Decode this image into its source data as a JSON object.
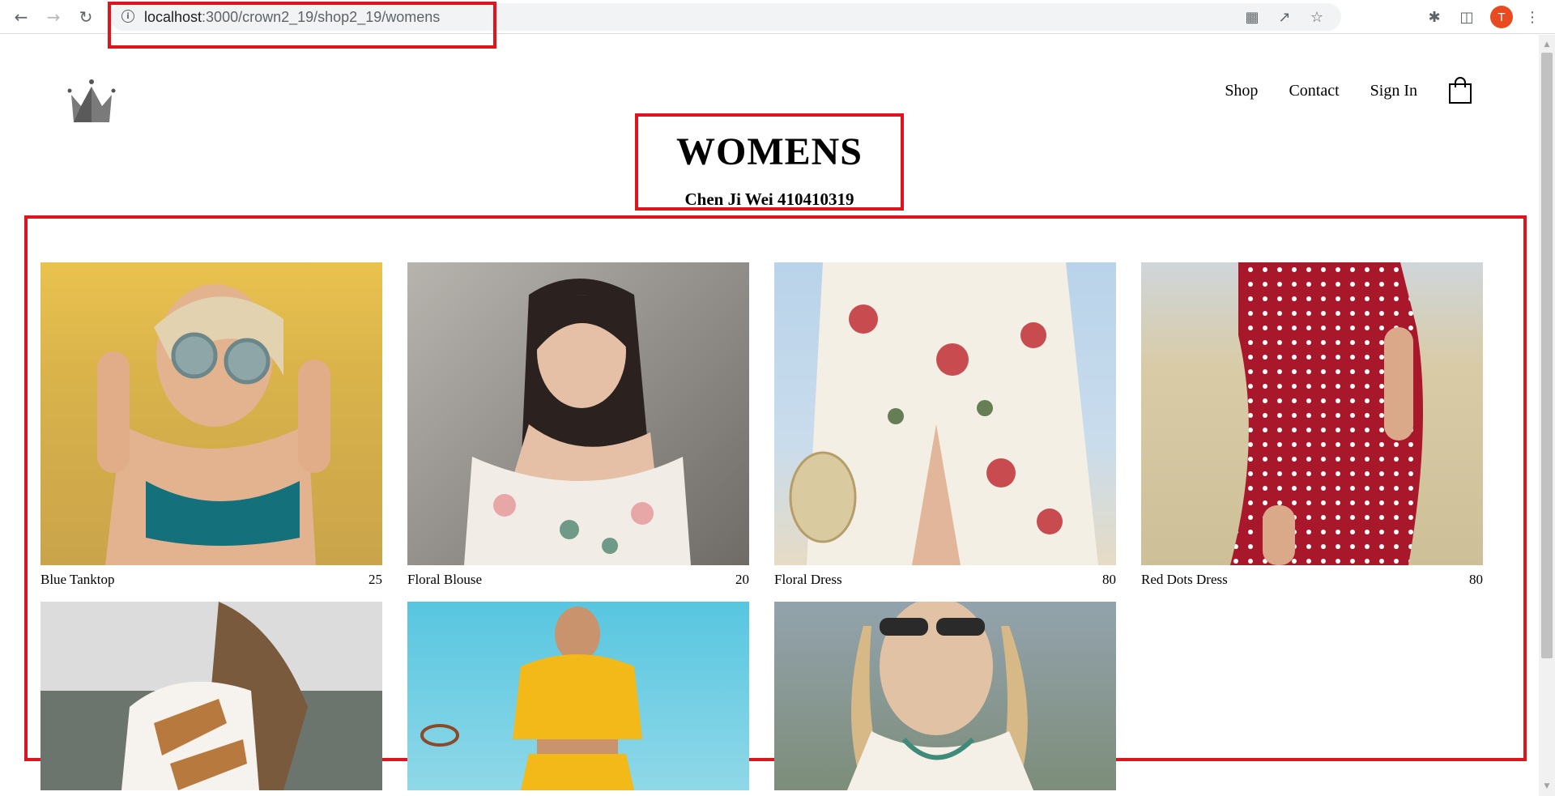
{
  "browser": {
    "url_host": "localhost",
    "url_path": ":3000/crown2_19/shop2_19/womens",
    "profile_initial": "T"
  },
  "header": {
    "nav": [
      "Shop",
      "Contact",
      "Sign In"
    ]
  },
  "collection": {
    "title": "WOMENS",
    "subtitle": "Chen Ji Wei 410410319"
  },
  "items": [
    {
      "name": "Blue Tanktop",
      "price": "25"
    },
    {
      "name": "Floral Blouse",
      "price": "20"
    },
    {
      "name": "Floral Dress",
      "price": "80"
    },
    {
      "name": "Red Dots Dress",
      "price": "80"
    },
    {
      "name": "",
      "price": ""
    },
    {
      "name": "",
      "price": ""
    },
    {
      "name": "",
      "price": ""
    }
  ],
  "colors": {
    "highlight_border": "#e0141e",
    "profile": "#ea4a1f"
  }
}
